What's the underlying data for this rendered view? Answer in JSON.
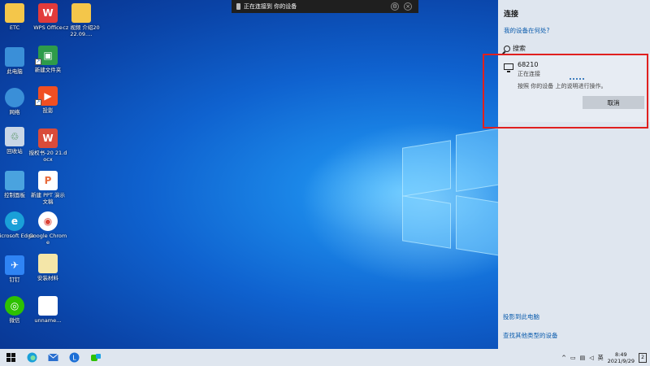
{
  "desktop_icons": [
    {
      "label": "ETC",
      "color": "#f4c64a",
      "glyph": ""
    },
    {
      "label": "WPS Office",
      "color": "#e23b3b",
      "glyph": "W"
    },
    {
      "label": "cz 视频 介绍2022.09.…",
      "color": "#f4c64a",
      "glyph": ""
    },
    {
      "label": "此电脑",
      "color": "#3a8fd8",
      "glyph": ""
    },
    {
      "label": "新建文件夹",
      "color": "#2e9b4a",
      "glyph": "▣"
    },
    {
      "label": "网络",
      "color": "#3a8fd8",
      "glyph": ""
    },
    {
      "label": "投影",
      "color": "#f04f23",
      "glyph": "▶"
    },
    {
      "label": "回收站",
      "color": "#c9d6e6",
      "glyph": "♲"
    },
    {
      "label": "授权书-20 21.docx",
      "color": "#d94b3a",
      "glyph": "W"
    },
    {
      "label": "控制面板",
      "color": "#4aa3df",
      "glyph": ""
    },
    {
      "label": "新建 PPT 演示文稿",
      "color": "#e86a3a",
      "glyph": "P"
    },
    {
      "label": "Microsoft Edge",
      "color": "#1aa0d8",
      "glyph": "e"
    },
    {
      "label": "Google Chrome",
      "color": "#ffffff",
      "glyph": "◉"
    },
    {
      "label": "钉钉",
      "color": "#2f84f4",
      "glyph": "✈"
    },
    {
      "label": "安装材料",
      "color": "#f4c64a",
      "glyph": ""
    },
    {
      "label": "微信",
      "color": "#2dc100",
      "glyph": "◎"
    },
    {
      "label": "unname…",
      "color": "#ffffff",
      "glyph": ""
    }
  ],
  "connect_banner": {
    "text": "正在连接到 你的设备"
  },
  "panel": {
    "title": "连接",
    "where_link": "我的设备在何处?",
    "search_label": "搜索",
    "device": {
      "name": "68210",
      "status": "正在连接",
      "instruction": "按照 你的设备 上的说明进行操作。",
      "cancel_label": "取消"
    },
    "project_link": "投影到此电脑",
    "find_other_link": "查找其他类型的设备"
  },
  "taskbar": {
    "ime": "英",
    "time": "8:49",
    "date": "2021/9/29",
    "notify_count": "2"
  },
  "colors": {
    "highlight": "#e0201f",
    "link": "#0b5cad",
    "panel_bg": "#dfe6ef"
  }
}
